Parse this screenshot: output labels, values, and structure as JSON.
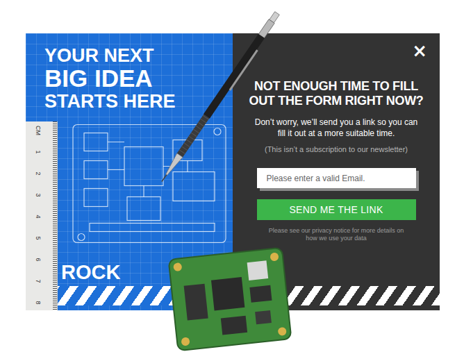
{
  "hero": {
    "headline": [
      {
        "text": "YOUR NEXT",
        "kind": "regular"
      },
      {
        "text": "BIG IDEA",
        "kind": "large"
      },
      {
        "text": "STARTS HERE",
        "kind": "regular"
      }
    ],
    "brand": "ROCK",
    "ruler": {
      "unit": "CM",
      "marks": [
        "1",
        "2",
        "3",
        "4",
        "5",
        "6",
        "7",
        "8"
      ]
    }
  },
  "dialog": {
    "close": "×",
    "title": "NOT ENOUGH TIME TO FILL OUT THE FORM RIGHT NOW?",
    "message": "Don’t worry, we’ll send you a link so you can fill it out at a more suitable time.",
    "note": "(This isn’t a subscription to our newsletter)",
    "email": {
      "placeholder": "Please enter a valid Email."
    },
    "submit": "SEND ME THE LINK",
    "privacy": "Please see our privacy notice for more details on how we use your data"
  }
}
